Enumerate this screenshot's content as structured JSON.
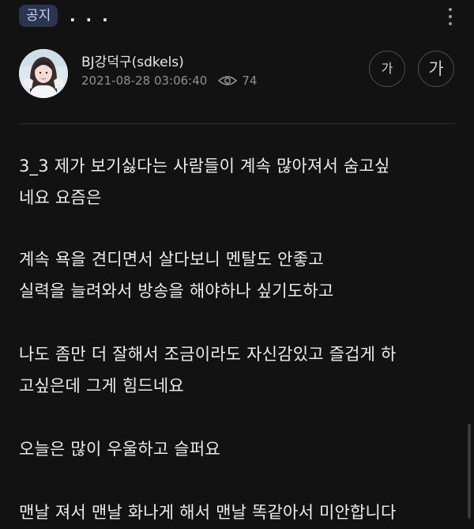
{
  "header": {
    "notice_label": "공지",
    "title": ". . ."
  },
  "author": {
    "name": "BJ강덕구(sdkels)",
    "date": "2021-08-28 03:06:40",
    "views": "74"
  },
  "font_controls": {
    "small_label": "가",
    "large_label": "가"
  },
  "body": {
    "lines": [
      "3_3 제가 보기싫다는 사람들이 계속 많아져서  숨고싶",
      "네요 요즘은",
      "계속 욕을 견디면서 살다보니 멘탈도 안좋고",
      "실력을 늘려와서 방송을 해야하나 싶기도하고",
      "나도 좀만 더 잘해서 조금이라도 자신감있고 즐겁게 하",
      "고싶은데 그게 힘드네요",
      "오늘은 많이 우울하고 슬퍼요",
      "맨날 져서 맨날 화나게 해서 맨날 똑같아서 미안합니다"
    ]
  },
  "icons": {
    "more": "more-vertical-icon",
    "views": "eye-icon"
  },
  "colors": {
    "background": "#121212",
    "badge_bg": "#2b3551",
    "badge_text": "#c8d3f2",
    "meta_text": "#8f8f8f"
  }
}
